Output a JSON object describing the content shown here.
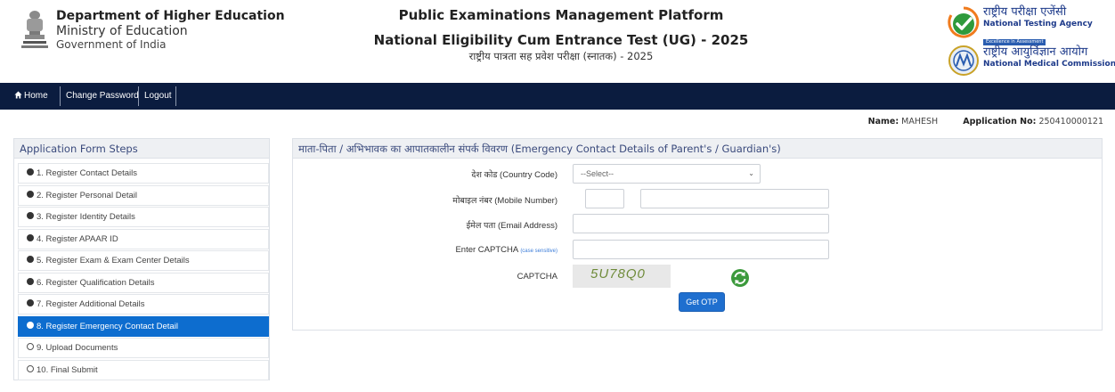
{
  "header": {
    "dept_name": "Department of Higher Education",
    "ministry": "Ministry of Education",
    "govt": "Government of India",
    "platform_title": "Public Examinations Management Platform",
    "exam_title": "National Eligibility Cum Entrance Test (UG) - 2025",
    "exam_title_hindi": "राष्ट्रीय पात्रता सह प्रवेश परीक्षा (स्नातक) - 2025",
    "nta_hindi": "राष्ट्रीय परीक्षा एजेंसी",
    "nta_english": "National Testing Agency",
    "nta_tagline": "Excellence in Assessment",
    "nmc_hindi": "राष्ट्रीय आयुर्विज्ञान आयोग",
    "nmc_english": "National Medical Commission"
  },
  "nav": {
    "home": "Home",
    "change_password": "Change Password",
    "logout": "Logout"
  },
  "info": {
    "name_label": "Name:",
    "name_value": "MAHESH",
    "app_label": "Application No:",
    "app_value": "250410000121"
  },
  "steps": {
    "title": "Application Form Steps",
    "items": [
      {
        "label": "1. Register Contact Details",
        "state": "done"
      },
      {
        "label": "2. Register Personal Detail",
        "state": "done"
      },
      {
        "label": "3. Register Identity Details",
        "state": "done"
      },
      {
        "label": "4. Register APAAR ID",
        "state": "done"
      },
      {
        "label": "5. Register Exam & Exam Center Details",
        "state": "done"
      },
      {
        "label": "6. Register Qualification Details",
        "state": "done"
      },
      {
        "label": "7. Register Additional Details",
        "state": "done"
      },
      {
        "label": "8. Register Emergency Contact Detail",
        "state": "active"
      },
      {
        "label": "9. Upload Documents",
        "state": "pending"
      },
      {
        "label": "10. Final Submit",
        "state": "pending"
      }
    ]
  },
  "form": {
    "title": "माता-पिता / अभिभावक का आपातकालीन संपर्क विवरण (Emergency Contact Details of Parent's / Guardian's)",
    "country_label": "देश कोड (Country Code)",
    "country_value": "--Select--",
    "mobile_label": "मोबाइल नंबर (Mobile Number)",
    "email_label": "ईमेल पता (Email Address)",
    "captcha_label": "Enter CAPTCHA",
    "captcha_hint": "(case sensitive)",
    "captcha_caption": "CAPTCHA",
    "captcha_code": "5U78Q0",
    "otp_button": "Get OTP"
  },
  "colors": {
    "navbar": "#0b1c3f",
    "active_step": "#0d6dcf",
    "button": "#1f6fcf",
    "panel_title": "#3a4a7c"
  }
}
